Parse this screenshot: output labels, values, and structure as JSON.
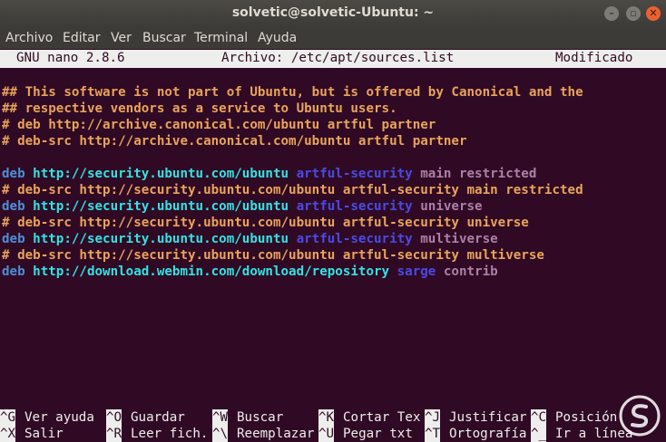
{
  "window": {
    "title": "solvetic@solvetic-Ubuntu: ~"
  },
  "menu": [
    "Archivo",
    "Editar",
    "Ver",
    "Buscar",
    "Terminal",
    "Ayuda"
  ],
  "nano_header": {
    "version": "GNU nano 2.8.6",
    "file": "Archivo: /etc/apt/sources.list",
    "status": "Modificado"
  },
  "lines": [
    {
      "segments": [
        {
          "t": "## This software is not part of Ubuntu, but is offered by Canonical and the",
          "c": "comment"
        }
      ]
    },
    {
      "segments": [
        {
          "t": "## respective vendors as a service to Ubuntu users.",
          "c": "comment"
        }
      ]
    },
    {
      "segments": [
        {
          "t": "# deb http://archive.canonical.com/ubuntu artful partner",
          "c": "comment"
        }
      ]
    },
    {
      "segments": [
        {
          "t": "# deb-src http://archive.canonical.com/ubuntu artful partner",
          "c": "comment"
        }
      ]
    },
    {
      "segments": []
    },
    {
      "segments": [
        {
          "t": "deb ",
          "c": "kw"
        },
        {
          "t": "http://security.ubuntu.com/ubuntu ",
          "c": "url"
        },
        {
          "t": "artful-security ",
          "c": "dist"
        },
        {
          "t": "main restricted",
          "c": "comp"
        }
      ]
    },
    {
      "segments": [
        {
          "t": "# deb-src http://security.ubuntu.com/ubuntu artful-security main restricted",
          "c": "comment"
        }
      ]
    },
    {
      "segments": [
        {
          "t": "deb ",
          "c": "kw"
        },
        {
          "t": "http://security.ubuntu.com/ubuntu ",
          "c": "url"
        },
        {
          "t": "artful-security ",
          "c": "dist"
        },
        {
          "t": "universe",
          "c": "comp"
        }
      ]
    },
    {
      "segments": [
        {
          "t": "# deb-src http://security.ubuntu.com/ubuntu artful-security universe",
          "c": "comment"
        }
      ]
    },
    {
      "segments": [
        {
          "t": "deb ",
          "c": "kw"
        },
        {
          "t": "http://security.ubuntu.com/ubuntu ",
          "c": "url"
        },
        {
          "t": "artful-security ",
          "c": "dist"
        },
        {
          "t": "multiverse",
          "c": "comp"
        }
      ]
    },
    {
      "segments": [
        {
          "t": "# deb-src http://security.ubuntu.com/ubuntu artful-security multiverse",
          "c": "comment"
        }
      ]
    },
    {
      "segments": [
        {
          "t": "deb ",
          "c": "kw"
        },
        {
          "t": "http://download.webmin.com/download/repository ",
          "c": "url"
        },
        {
          "t": "sarge ",
          "c": "dist"
        },
        {
          "t": "contrib",
          "c": "comp"
        }
      ]
    }
  ],
  "help_rows": [
    [
      {
        "key": "^G",
        "label": "Ver ayuda"
      },
      {
        "key": "^O",
        "label": "Guardar"
      },
      {
        "key": "^W",
        "label": "Buscar"
      },
      {
        "key": "^K",
        "label": "Cortar Tex"
      },
      {
        "key": "^J",
        "label": "Justificar"
      },
      {
        "key": "^C",
        "label": "Posición"
      }
    ],
    [
      {
        "key": "^X",
        "label": "Salir"
      },
      {
        "key": "^R",
        "label": "Leer fich."
      },
      {
        "key": "^\\",
        "label": "Reemplazar"
      },
      {
        "key": "^U",
        "label": "Pegar txt"
      },
      {
        "key": "^T",
        "label": "Ortografía"
      },
      {
        "key": "^_",
        "label": "Ir a línea"
      }
    ]
  ],
  "colors": {
    "background": "#300a24",
    "comment": "#e9a35b",
    "keyword": "#4d8fd8",
    "url": "#34e2e2",
    "distribution": "#4a4ae6",
    "component": "#ad7fa8"
  }
}
